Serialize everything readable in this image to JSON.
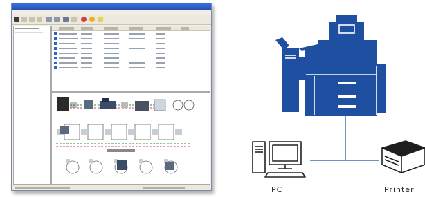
{
  "diagram": {
    "pc_label": "PC",
    "printer_label": "Printer",
    "colors": {
      "copier": "#1f4fa0",
      "line": "#1f4fa0",
      "outline": "#222222"
    },
    "icons": [
      "copier-icon",
      "pc-icon",
      "printer-icon"
    ]
  }
}
